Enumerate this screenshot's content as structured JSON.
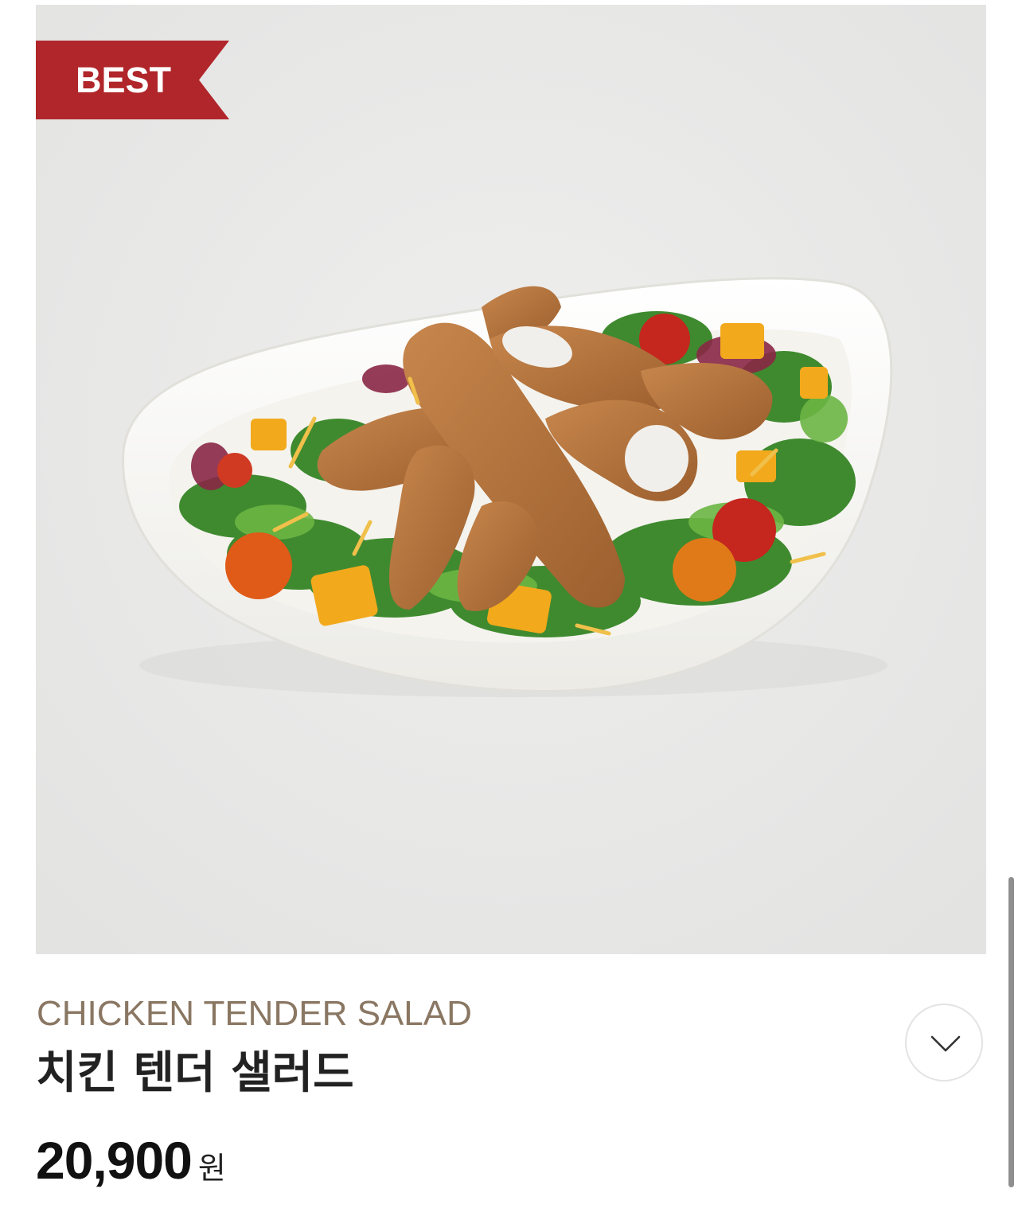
{
  "product": {
    "badge": "BEST",
    "name_en": "CHICKEN TENDER SALAD",
    "name_ko": "치킨 텐더 샐러드",
    "price": "20,900",
    "currency": "원",
    "image_icon": "salad-photo"
  },
  "colors": {
    "badge_red": "#b0262a",
    "name_en": "#8a7763",
    "photo_bg": "#e9e9e8"
  },
  "controls": {
    "expand_icon": "chevron-down-icon"
  }
}
